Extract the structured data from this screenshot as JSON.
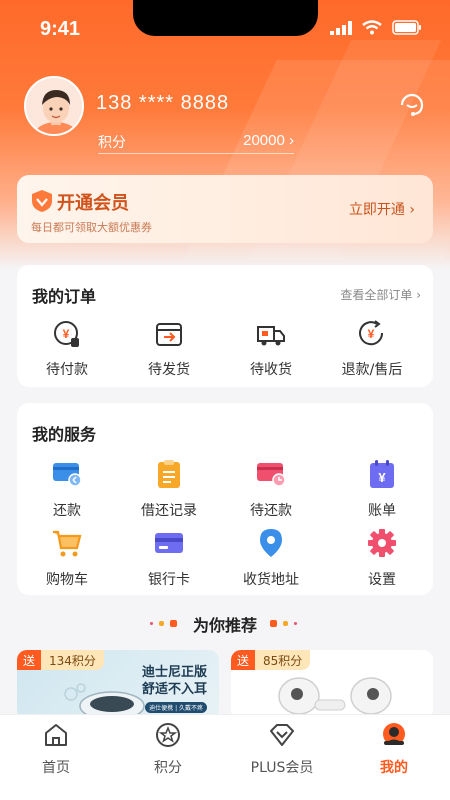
{
  "status_bar": {
    "time": "9:41"
  },
  "profile": {
    "phone": "138 **** 8888",
    "points_label": "积分",
    "points_value": "20000",
    "chevron": "›"
  },
  "member": {
    "title": "开通会员",
    "subtitle": "每日都可领取大额优惠券",
    "cta": "立即开通 ›"
  },
  "orders": {
    "title": "我的订单",
    "view_all": "查看全部订单 ›",
    "items": [
      {
        "label": "待付款",
        "icon": "yuan-hourglass-icon"
      },
      {
        "label": "待发货",
        "icon": "box-arrow-icon"
      },
      {
        "label": "待收货",
        "icon": "truck-icon"
      },
      {
        "label": "退款/售后",
        "icon": "refund-icon"
      }
    ]
  },
  "services": {
    "title": "我的服务",
    "items": [
      {
        "label": "还款",
        "icon": "card-repay-icon"
      },
      {
        "label": "借还记录",
        "icon": "clipboard-icon"
      },
      {
        "label": "待还款",
        "icon": "card-pending-icon"
      },
      {
        "label": "账单",
        "icon": "bill-icon"
      },
      {
        "label": "购物车",
        "icon": "cart-icon"
      },
      {
        "label": "银行卡",
        "icon": "bank-card-icon"
      },
      {
        "label": "收货地址",
        "icon": "location-pin-icon"
      },
      {
        "label": "设置",
        "icon": "gear-icon"
      }
    ]
  },
  "recommend": {
    "title": "为你推荐",
    "products": [
      {
        "tag": "送",
        "points": "134积分",
        "headline1": "迪士尼正版",
        "headline2": "舒适不入耳",
        "subtag": "迪仕便携 | 久戴不疼"
      },
      {
        "tag": "送",
        "points": "85积分"
      }
    ]
  },
  "tabbar": {
    "tabs": [
      {
        "label": "首页",
        "icon": "home-icon"
      },
      {
        "label": "积分",
        "icon": "star-coin-icon"
      },
      {
        "label": "PLUS会员",
        "icon": "diamond-icon"
      },
      {
        "label": "我的",
        "icon": "profile-icon",
        "active": true
      }
    ]
  },
  "colors": {
    "accent": "#ff5a1f",
    "header": "#ff6a2a",
    "member_text": "#d1531c"
  }
}
